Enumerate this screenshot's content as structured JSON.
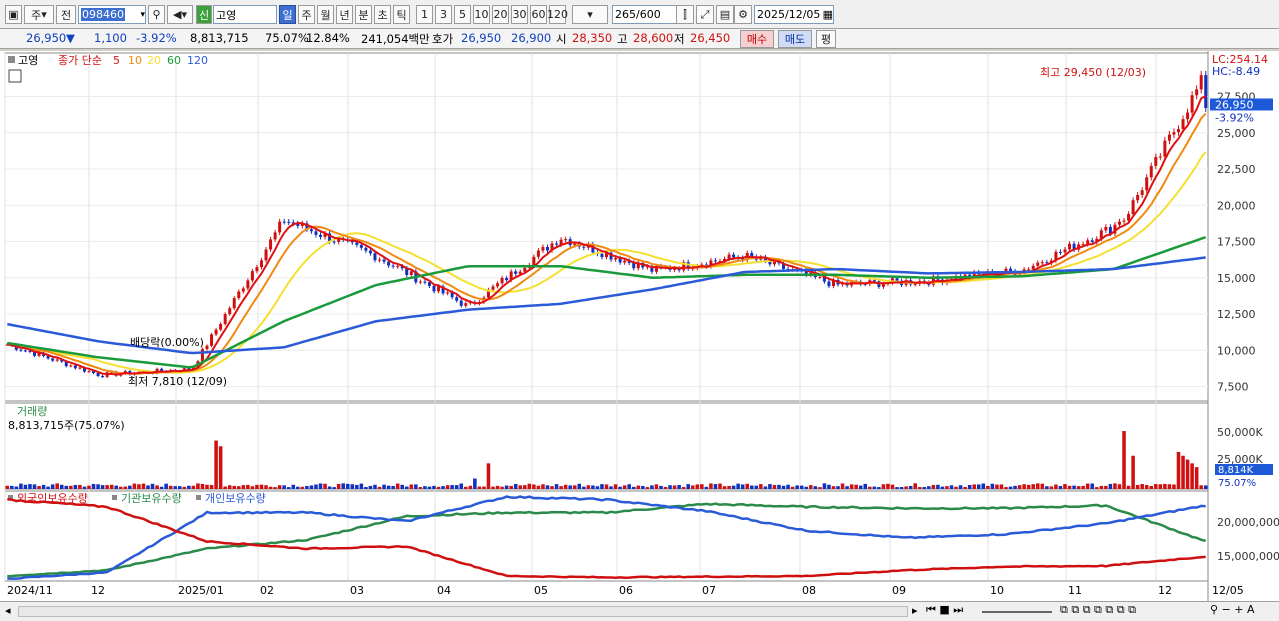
{
  "toolbar": {
    "type_label": "주",
    "prev_label": "전",
    "code": "098460",
    "market_badge": "신",
    "name": "고영",
    "periods": [
      "일",
      "주",
      "월",
      "년",
      "분",
      "초",
      "틱"
    ],
    "intervals": [
      "1",
      "3",
      "5",
      "10",
      "20",
      "30",
      "60",
      "120"
    ],
    "count": "265",
    "count_max": "/600",
    "date": "2025/12/05"
  },
  "quote": {
    "price": "26,950",
    "arrow": "▼",
    "change": "1,100",
    "change_pct": "-3.92%",
    "volume": "8,813,715",
    "vol_ratio": "75.07%",
    "turnover": "12.84%",
    "amount": "241,054백만",
    "bid_label": "호가",
    "ask": "26,950",
    "bid": "26,900",
    "open_label": "시",
    "open": "28,350",
    "high_label": "고",
    "high": "28,600",
    "low_label": "저",
    "low": "26,450",
    "buy_label": "매수",
    "sell_label": "매도",
    "eval_label": "평"
  },
  "price_panel": {
    "stock_tag": "고영",
    "ma_title": "종가 단순",
    "ma_periods": [
      "5",
      "10",
      "20",
      "60",
      "120"
    ],
    "ma_colors": [
      "#e01010",
      "#f08a10",
      "#f5e030",
      "#1a9a3a",
      "#2a5ad8"
    ],
    "lc": "LC:254.14",
    "hc": "HC:-8.49",
    "yticks": [
      "27,500",
      "25,000",
      "22,500",
      "20,000",
      "17,500",
      "15,000",
      "12,500",
      "10,000",
      "7,500"
    ],
    "current_price": "26,950",
    "current_pct": "-3.92%",
    "high_note": "최고 29,450 (12/03)",
    "low_note": "최저 7,810 (12/09)",
    "dividend_note": "배당락(0.00%)"
  },
  "volume_panel": {
    "title": "거래량",
    "value": "8,813,715주(75.07%)",
    "yticks": [
      "50,000K",
      "25,000K"
    ],
    "current": "8,814K",
    "current_pct": "75.07%"
  },
  "holding_panel": {
    "legend": [
      "외국인보유수량",
      "기관보유수량",
      "개인보유수량"
    ],
    "colors": [
      "#d01010",
      "#2a8a4a",
      "#2a5ad8"
    ],
    "yticks": [
      "20,000,000",
      "15,000,000"
    ]
  },
  "xaxis": {
    "labels": [
      "2024/11",
      "12",
      "2025/01",
      "02",
      "03",
      "04",
      "05",
      "06",
      "07",
      "08",
      "09",
      "10",
      "11",
      "12",
      "12/05"
    ]
  },
  "chart_data": {
    "type": "candlestick",
    "title": "",
    "xlabel": "",
    "ylabel": "",
    "ylim": [
      6500,
      30500
    ],
    "months": [
      "2024/11",
      "12",
      "2025/01",
      "02",
      "03",
      "04",
      "05",
      "06",
      "07",
      "08",
      "09",
      "10",
      "11",
      "12"
    ],
    "close_path_monthly": [
      10400,
      8300,
      8700,
      19000,
      16500,
      13000,
      17800,
      15500,
      16500,
      14500,
      14800,
      15500,
      18500,
      26950
    ],
    "ma60_path_monthly": [
      10500,
      9500,
      8800,
      12000,
      14500,
      15800,
      15800,
      15000,
      15200,
      15200,
      15000,
      15100,
      15600,
      17800
    ],
    "ma120_path_monthly": [
      11800,
      10600,
      9800,
      10200,
      12000,
      12800,
      13200,
      14200,
      15400,
      15600,
      15300,
      15400,
      15600,
      16400
    ],
    "high": 29450,
    "low": 7810,
    "volume_peaks_k": [
      51000,
      27000,
      61000,
      39000
    ],
    "holdings": {
      "foreign_start": 22800000,
      "foreign_end": 14900000,
      "institution_end": 17000000,
      "individual_end": 22000000
    }
  }
}
